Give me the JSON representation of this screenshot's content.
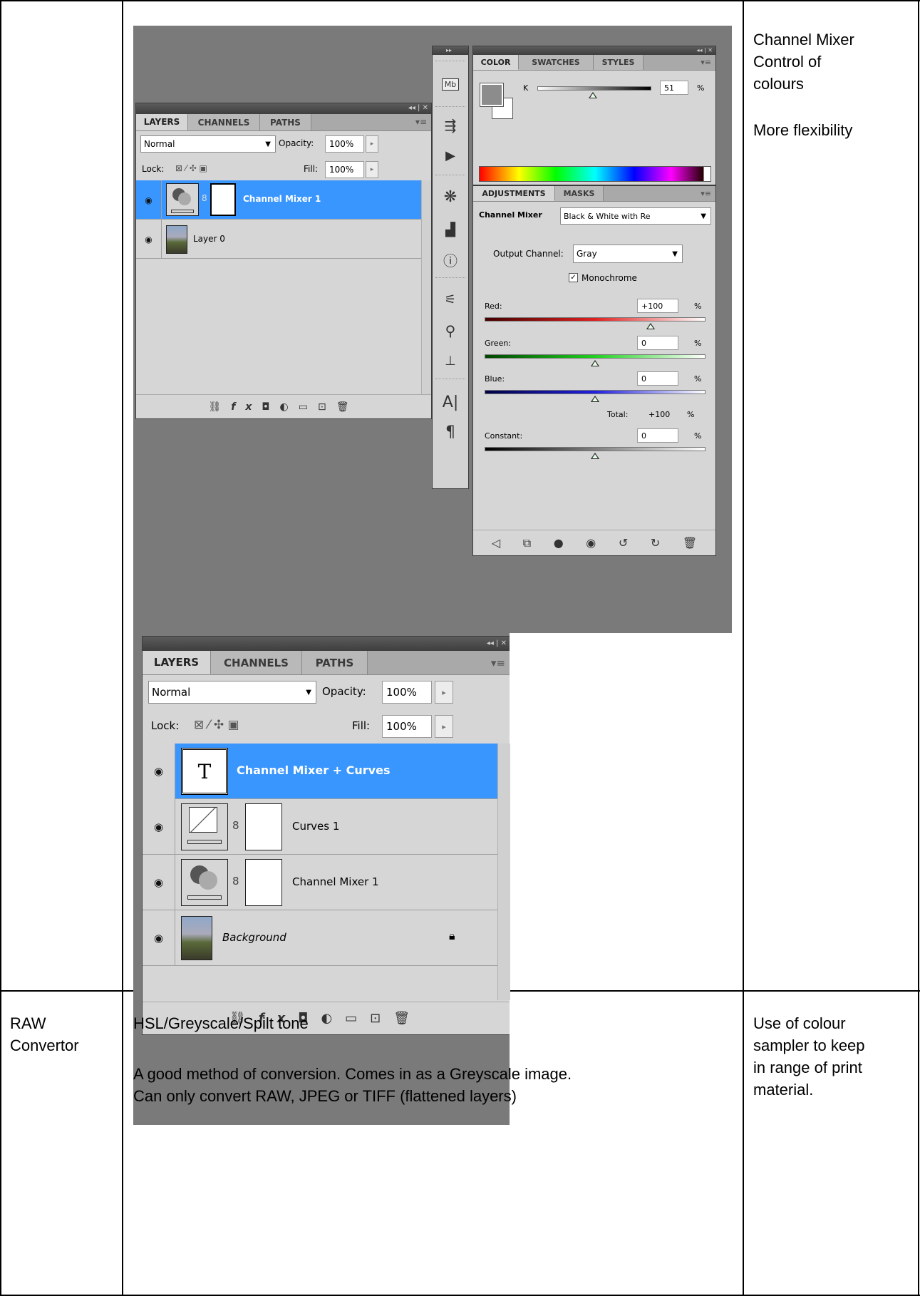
{
  "row1": {
    "notes": [
      "Channel Mixer",
      "Control of",
      "colours",
      "More flexibility"
    ]
  },
  "panel1": {
    "tabs": [
      "LAYERS",
      "CHANNELS",
      "PATHS"
    ],
    "blend_mode": "Normal",
    "opacity_label": "Opacity:",
    "opacity_value": "100%",
    "lock_label": "Lock:",
    "fill_label": "Fill:",
    "fill_value": "100%",
    "layers": [
      "Channel Mixer 1",
      "Layer 0"
    ]
  },
  "color_panel": {
    "tabs": [
      "COLOR",
      "SWATCHES",
      "STYLES"
    ],
    "k_label": "K",
    "k_value": "51",
    "percent": "%"
  },
  "dock_icons": [
    "mini-bridge-icon",
    "history-icon",
    "actions-icon",
    "navigator-icon",
    "histogram-icon",
    "info-icon",
    "brush-presets-icon",
    "clone-source-icon",
    "tool-presets-icon",
    "character-icon",
    "paragraph-icon"
  ],
  "dock_glyphs": {
    "mb": "Mb",
    "char": "A|",
    "para": "¶"
  },
  "adjustments": {
    "tabs": [
      "ADJUSTMENTS",
      "MASKS"
    ],
    "title": "Channel Mixer",
    "preset": "Black & White with Re",
    "output_label": "Output Channel:",
    "output_value": "Gray",
    "monochrome_label": "Monochrome",
    "red_label": "Red:",
    "red_value": "+100",
    "green_label": "Green:",
    "green_value": "0",
    "blue_label": "Blue:",
    "blue_value": "0",
    "total_label": "Total:",
    "total_value": "+100",
    "constant_label": "Constant:",
    "constant_value": "0",
    "percent": "%"
  },
  "panel2": {
    "tabs": [
      "LAYERS",
      "CHANNELS",
      "PATHS"
    ],
    "blend_mode": "Normal",
    "opacity_label": "Opacity:",
    "opacity_value": "100%",
    "lock_label": "Lock:",
    "fill_label": "Fill:",
    "fill_value": "100%",
    "layers": [
      "Channel Mixer + Curves",
      "Curves 1",
      "Channel Mixer 1",
      "Background"
    ],
    "text_thumb": "T"
  },
  "row2": {
    "col1": [
      "RAW",
      "Convertor"
    ],
    "col2": [
      "HSL/Greyscale/Spilt tone",
      "A good method of conversion.  Comes in as a Greyscale image.",
      "Can only convert RAW, JPEG or TIFF (flattened layers)"
    ],
    "col3": [
      "Use of colour",
      "sampler to keep",
      "in range of print",
      "material."
    ]
  }
}
